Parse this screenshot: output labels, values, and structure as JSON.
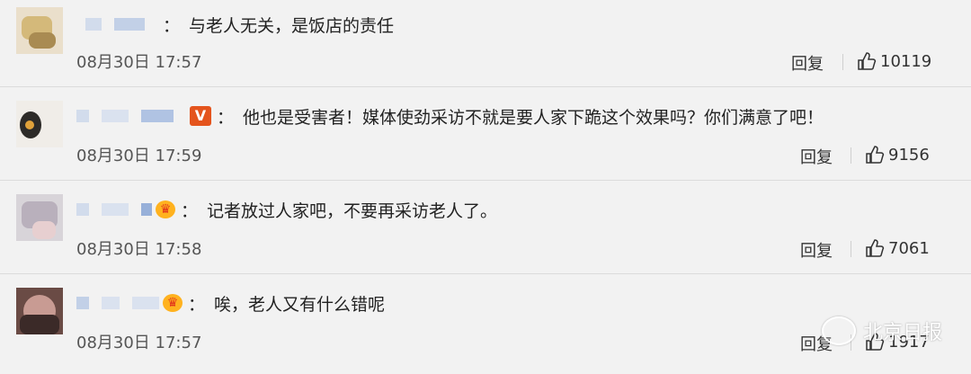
{
  "comments": [
    {
      "text": "与老人无关，是饭店的责任",
      "date": "08月30日 17:57",
      "reply": "回复",
      "likes": "10119",
      "badge": ""
    },
    {
      "text": "他也是受害者！媒体使劲采访不就是要人家下跪这个效果吗？你们满意了吧！",
      "date": "08月30日 17:59",
      "reply": "回复",
      "likes": "9156",
      "badge": "V"
    },
    {
      "text": "记者放过人家吧，不要再采访老人了。",
      "date": "08月30日 17:58",
      "reply": "回复",
      "likes": "7061",
      "badge": "crown"
    },
    {
      "text": "唉，老人又有什么错呢",
      "date": "08月30日 17:57",
      "reply": "回复",
      "likes": "1917",
      "badge": "crown"
    }
  ],
  "colon": "：",
  "watermark": {
    "text": "北京日报"
  },
  "icons": {
    "like": "thumbs-up-icon",
    "watermark": "wechat-icon"
  },
  "colors": {
    "background": "#f2f2f2",
    "vip": "#e4541d",
    "crown": "#ffb21f"
  }
}
